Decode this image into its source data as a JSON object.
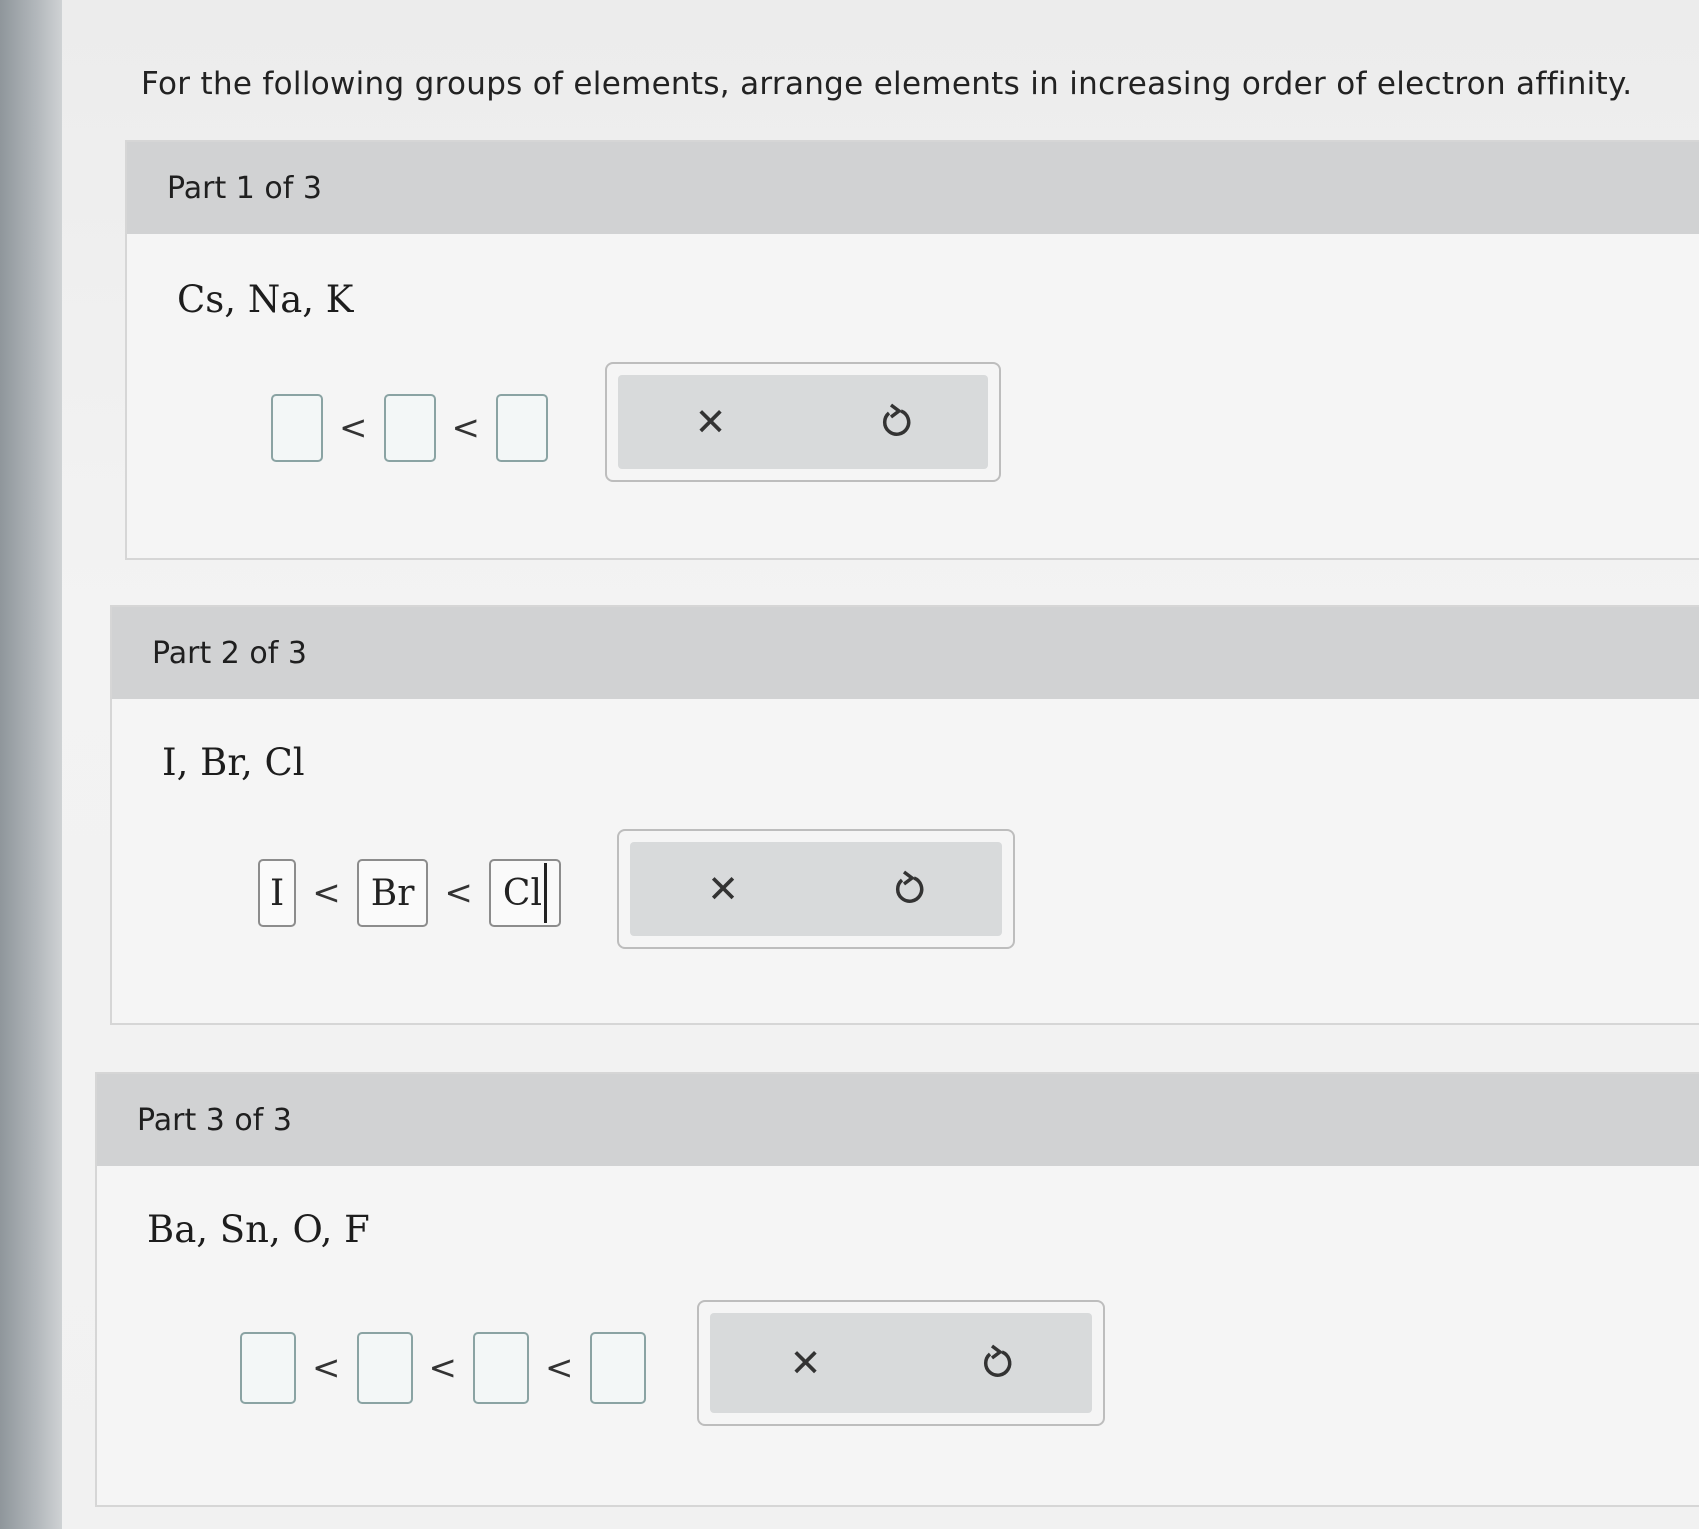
{
  "prompt": "For the following groups of elements, arrange elements in increasing order of electron affinity.",
  "parts": [
    {
      "header": "Part 1 of 3",
      "elements": "Cs, Na, K",
      "slots": [
        "",
        "",
        ""
      ],
      "separator": "<",
      "tools": {
        "clear_icon": "✕",
        "undo_icon": "undo-icon"
      }
    },
    {
      "header": "Part 2 of 3",
      "elements": "I, Br, Cl",
      "slots": [
        "I",
        "Br",
        "Cl"
      ],
      "separator": "<",
      "tools": {
        "clear_icon": "✕",
        "undo_icon": "undo-icon"
      }
    },
    {
      "header": "Part 3 of 3",
      "elements": "Ba, Sn, O, F",
      "slots": [
        "",
        "",
        "",
        ""
      ],
      "separator": "<",
      "tools": {
        "clear_icon": "✕",
        "undo_icon": "undo-icon"
      }
    }
  ]
}
